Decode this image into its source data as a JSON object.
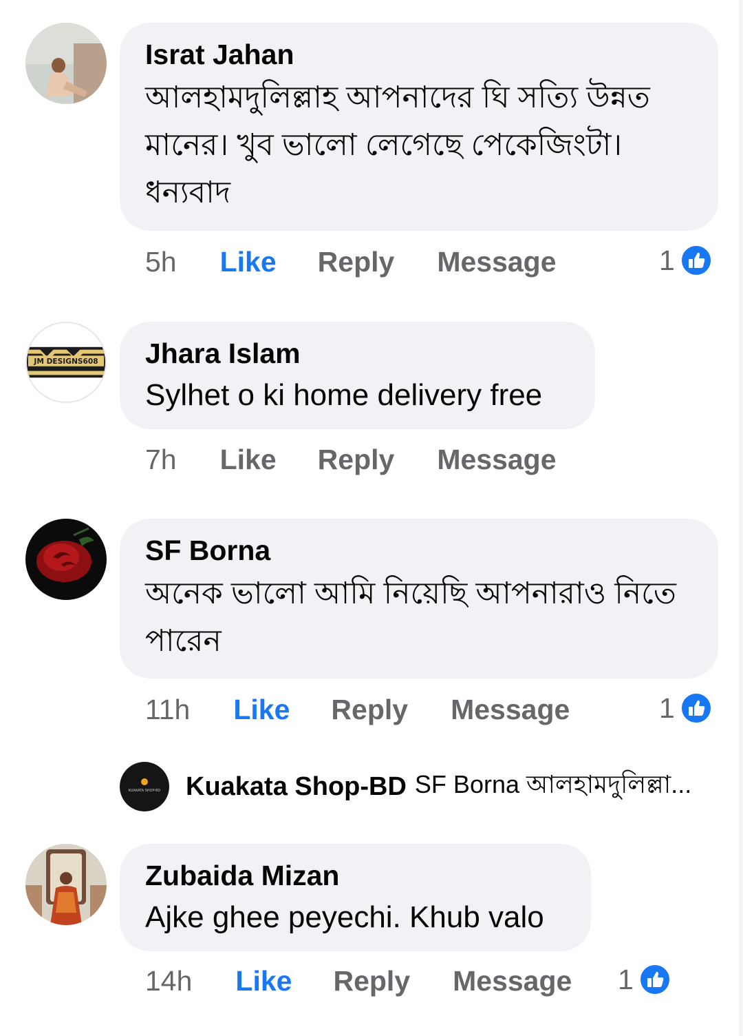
{
  "comments": [
    {
      "author": "Israt Jahan",
      "avatar_icon": "profile-photo-avatar",
      "text": "আলহামদুলিল্লাহ  আপনাদের ঘি সত্যি উন্নত মানের। খুব ভালো  লেগেছে পেকেজিংটা। ধন্যবাদ",
      "time": "5h",
      "like_label": "Like",
      "reply_label": "Reply",
      "message_label": "Message",
      "reaction_count": "1",
      "liked": true
    },
    {
      "author": "Jhara Islam",
      "avatar_icon": "jm-designs-logo-avatar",
      "avatar_logo_text": "JM DESIGNS608",
      "text": "Sylhet o ki home delivery free",
      "time": "7h",
      "like_label": "Like",
      "reply_label": "Reply",
      "message_label": "Message",
      "liked": false
    },
    {
      "author": "SF Borna",
      "avatar_icon": "red-rose-avatar",
      "text": "অনেক ভালো আমি নিয়েছি আপনারাও নিতে পারেন",
      "time": "11h",
      "like_label": "Like",
      "reply_label": "Reply",
      "message_label": "Message",
      "reaction_count": "1",
      "liked": true
    },
    {
      "author": "Zubaida Mizan",
      "avatar_icon": "profile-photo-avatar",
      "text": "Ajke ghee peyechi. Khub valo",
      "time": "14h",
      "like_label": "Like",
      "reply_label": "Reply",
      "message_label": "Message",
      "reaction_count": "1",
      "liked": true
    }
  ],
  "reply_preview": {
    "author": "Kuakata Shop-BD",
    "avatar_icon": "kuakata-shop-logo-avatar",
    "logo_text": "KUAKATA SHOP-BD",
    "text": "SF Borna আলহামদুলিল্লা..."
  },
  "colors": {
    "bubble_bg": "#f0f2f5",
    "like_active": "#1877f2",
    "secondary_text": "#65676b",
    "reaction_blue": "#1877f2"
  }
}
